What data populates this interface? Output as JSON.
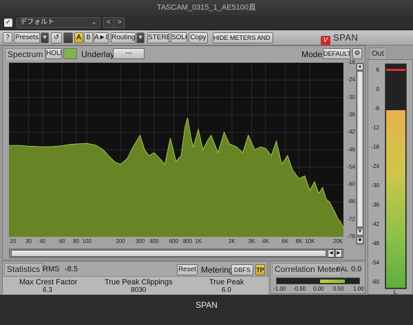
{
  "window": {
    "title": "TASCAM_0315_1_AE5100直"
  },
  "host": {
    "preset_value": "デフォルト",
    "prev_label": "<",
    "next_label": ">"
  },
  "toolbar": {
    "help": "?",
    "presets": "Presets",
    "undo_icon": "undo-icon",
    "a": "A",
    "b": "B",
    "ab": "A►B",
    "routing": "Routing",
    "stereo": "STEREO",
    "solo": "SOLO",
    "copy": "Copy",
    "hide": "HIDE METERS AND STATS",
    "brand": "SPAN",
    "brand_logo": "V"
  },
  "spectrum": {
    "tab": "Spectrum",
    "hold": "HOLD",
    "underlay_label": "Underlay",
    "underlay_value": "---",
    "mode_label": "Mode",
    "mode_value": "DEFAULT"
  },
  "chart_data": {
    "type": "area",
    "y_ticks": [
      "-18",
      "-24",
      "-30",
      "-36",
      "-42",
      "-48",
      "-54",
      "-60",
      "-66",
      "-72",
      "-78"
    ],
    "x_ticks": [
      "20",
      "30",
      "40",
      "60",
      "80",
      "100",
      "200",
      "300",
      "400",
      "600",
      "800",
      "1K",
      "2K",
      "3K",
      "4K",
      "6K",
      "8K",
      "10K",
      "20K"
    ],
    "ylim": [
      -78,
      -18
    ],
    "xlim": [
      20,
      20000
    ],
    "x_scale": "log",
    "grid": true,
    "series": [
      {
        "x": [
          20,
          25,
          30,
          40,
          50,
          60,
          70,
          80,
          100,
          120,
          140,
          160,
          180,
          200,
          230,
          260,
          300,
          330,
          360,
          400,
          450,
          500,
          560,
          630,
          700,
          760,
          800,
          860,
          900,
          1000,
          1100,
          1200,
          1300,
          1500,
          1700,
          1900,
          2200,
          2500,
          2800,
          3200,
          3600,
          4000,
          4500,
          5000,
          5600,
          6300,
          7000,
          8000,
          9000,
          10000,
          11000,
          12000,
          13000,
          14000,
          15000,
          16000,
          17000,
          18000,
          19000,
          20000
        ],
        "y": [
          -46.5,
          -46.5,
          -46.8,
          -47,
          -46.9,
          -46.6,
          -46.2,
          -46,
          -45.8,
          -46.4,
          -48,
          -50.5,
          -52.3,
          -53,
          -51,
          -47,
          -43,
          -48,
          -50,
          -49,
          -51,
          -53,
          -44,
          -52,
          -50,
          -40,
          -37,
          -44,
          -47,
          -41,
          -48,
          -45,
          -43,
          -49,
          -42,
          -46,
          -47,
          -49,
          -43,
          -48,
          -47,
          -47.5,
          -50,
          -45,
          -53,
          -50,
          -55,
          -58,
          -57,
          -62,
          -59,
          -63,
          -61,
          -65,
          -66,
          -68,
          -70,
          -72,
          -73,
          -75
        ]
      }
    ],
    "colors": {
      "fill": "#6f8f27",
      "line": "#a7c94b",
      "background": "#111111",
      "grid": "#2a2a2a"
    }
  },
  "statistics": {
    "tab": "Statistics",
    "rms_label": "RMS",
    "rms_value": "-8.5",
    "reset": "Reset",
    "metering_label": "Metering",
    "metering_value": "DBFS",
    "tp": "TP",
    "cols": [
      {
        "label": "Max Crest Factor",
        "value": "6.3"
      },
      {
        "label": "True Peak Clippings",
        "value": "8030"
      },
      {
        "label": "True Peak",
        "value": "6.0"
      }
    ]
  },
  "correlation": {
    "title": "Correlation Meter",
    "bal_label": "BAL",
    "bal_value": "0.0",
    "ticks": [
      "-1.00",
      "-0.50",
      "0.00",
      "0.50",
      "1.00"
    ]
  },
  "output": {
    "tab": "Out",
    "ticks": [
      "6",
      "0",
      "-6",
      "-12",
      "-18",
      "-24",
      "-30",
      "-36",
      "-42",
      "-48",
      "-54",
      "-60"
    ],
    "l_label": "L",
    "level_db": -1.5
  },
  "footer": {
    "label": "SPAN"
  }
}
